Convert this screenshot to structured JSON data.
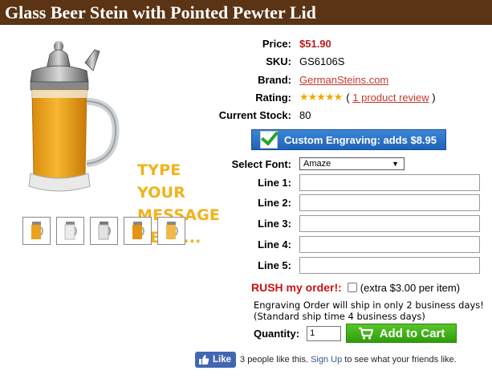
{
  "product": {
    "title": "Glass Beer Stein with Pointed Pewter Lid",
    "image_overlay_lines": [
      "TYPE YOUR",
      "MESSAGE",
      "HERE..."
    ]
  },
  "info": {
    "price_label": "Price:",
    "price": "$51.90",
    "sku_label": "SKU:",
    "sku": "GS6106S",
    "brand_label": "Brand:",
    "brand": "GermanSteins.com",
    "rating_label": "Rating:",
    "rating_stars": 5,
    "rating_open": "(",
    "rating_link": "1 product review",
    "rating_close": ")",
    "stock_label": "Current Stock:",
    "stock": "80"
  },
  "engraving": {
    "button_label": "Custom Engraving: adds $8.95",
    "font_label": "Select Font:",
    "font_selected": "Amaze",
    "lines": [
      {
        "label": "Line 1:",
        "value": ""
      },
      {
        "label": "Line 2:",
        "value": ""
      },
      {
        "label": "Line 3:",
        "value": ""
      },
      {
        "label": "Line 4:",
        "value": ""
      },
      {
        "label": "Line 5:",
        "value": ""
      }
    ]
  },
  "rush": {
    "label": "RUSH my order!:",
    "extra": "(extra $3.00 per item)",
    "checked": false,
    "note_line1": "Engraving Order will ship in only 2 business days!",
    "note_line2": "(Standard ship time 4 business days)"
  },
  "cart": {
    "qty_label": "Quantity:",
    "qty_value": "1",
    "add_label": "Add to Cart"
  },
  "facebook": {
    "like_label": "Like",
    "text_before": "3 people like this.",
    "signup_link": "Sign Up",
    "text_after": "to see what your friends like."
  },
  "colors": {
    "title_bar": "#5a3414",
    "price": "#b21e1e",
    "link": "#c0392b",
    "engrave_button": "#1f63b6",
    "cart_button": "#2f9e0c",
    "rush": "#cc1111",
    "overlay_text": "#f2b21b"
  }
}
